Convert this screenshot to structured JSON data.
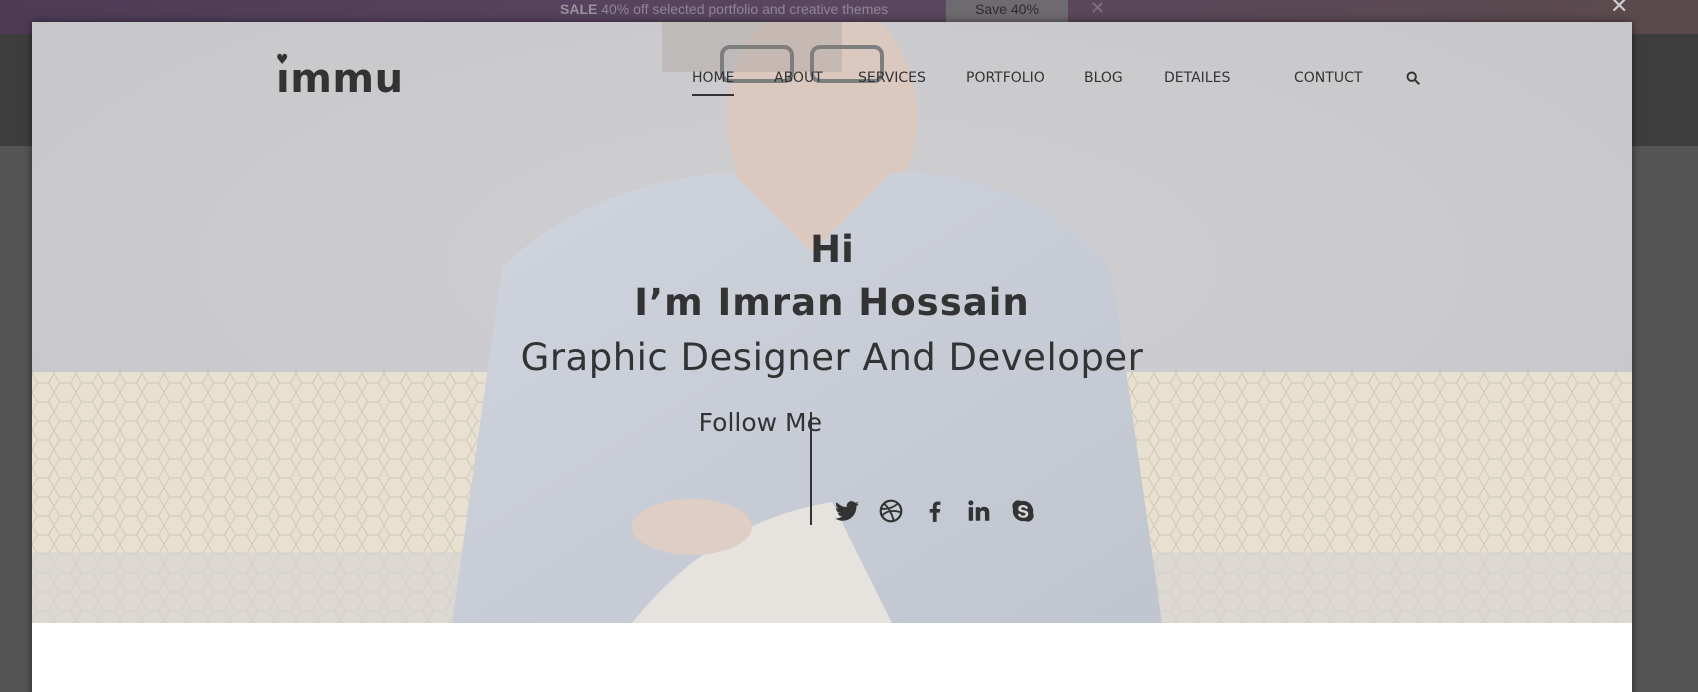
{
  "promo": {
    "sale_word": "SALE",
    "text": "40% off selected portfolio and creative themes",
    "button_label": "Save 40%",
    "close_symbol": "✕"
  },
  "modal": {
    "close_symbol": "✕"
  },
  "header": {
    "logo": "mmu",
    "logo_icon": "heart-icon",
    "nav": [
      {
        "label": "HOME",
        "active": true
      },
      {
        "label": "ABOUT"
      },
      {
        "label": "SERVICES"
      },
      {
        "label": "PORTFOLIO"
      },
      {
        "label": "BLOG"
      },
      {
        "label": "DETAILES"
      },
      {
        "label": "CONTUCT"
      }
    ],
    "search_icon": "search-icon"
  },
  "hero": {
    "greeting": "Hi",
    "name": "I’m Imran Hossain",
    "role": "Graphic Designer And Developer",
    "follow_label": "Follow Me",
    "social": [
      {
        "icon": "twitter-icon"
      },
      {
        "icon": "dribbble-icon"
      },
      {
        "icon": "facebook-icon"
      },
      {
        "icon": "linkedin-icon"
      },
      {
        "icon": "skype-icon"
      }
    ]
  },
  "colors": {
    "text": "#333333",
    "promo_bg": "#4d3b56",
    "overlay": "#555555"
  }
}
